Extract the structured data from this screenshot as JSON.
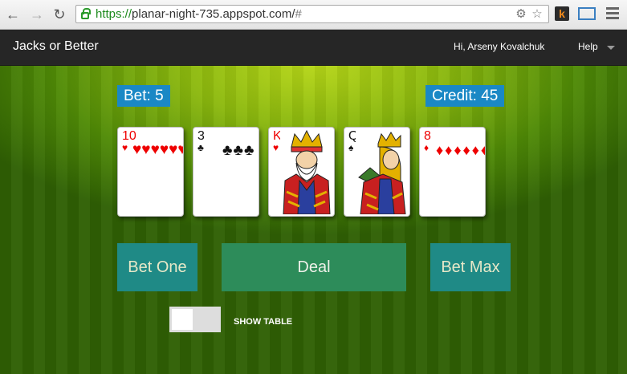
{
  "browser": {
    "url_scheme": "https://",
    "url_host": "planar-night-735.appspot.com/",
    "url_hash": "#",
    "extension_label": "k"
  },
  "navbar": {
    "brand": "Jacks or Better",
    "greeting": "Hi, Arseny Kovalchuk",
    "help": "Help"
  },
  "game": {
    "bet_label": "Bet: 5",
    "credit_label": "Credit: 45",
    "cards": [
      {
        "rank": "10",
        "suit": "♥",
        "color": "#e00000",
        "face": false,
        "pips": "♥♥♥♥♥♥♥♥♥♥"
      },
      {
        "rank": "3",
        "suit": "♣",
        "color": "#111111",
        "face": false,
        "pips": "♣♣♣"
      },
      {
        "rank": "K",
        "suit": "♥",
        "color": "#e00000",
        "face": true
      },
      {
        "rank": "Q",
        "suit": "♠",
        "color": "#111111",
        "face": true
      },
      {
        "rank": "8",
        "suit": "♦",
        "color": "#e00000",
        "face": false,
        "pips": "♦♦♦♦♦♦♦♦"
      }
    ],
    "buttons": {
      "bet_one": "Bet One",
      "deal": "Deal",
      "bet_max": "Bet Max"
    },
    "show_table_label": "SHOW TABLE",
    "show_table_on": false
  }
}
